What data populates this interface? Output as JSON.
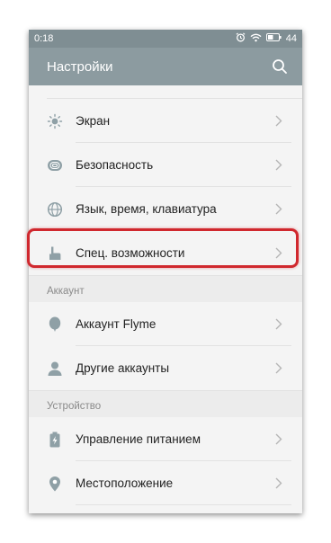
{
  "status_bar": {
    "time": "0:18",
    "battery": "44"
  },
  "app_bar": {
    "title": "Настройки"
  },
  "colors": {
    "accent_bar": "#8c9ba0",
    "icon": "#8fa0a6",
    "highlight": "#d0282e"
  },
  "settings": {
    "display_label": "Экран",
    "security_label": "Безопасность",
    "language_label": "Язык, время, клавиатура",
    "accessibility_label": "Спец. возможности"
  },
  "account": {
    "header": "Аккаунт",
    "flyme_label": "Аккаунт Flyme",
    "other_label": "Другие аккаунты"
  },
  "device": {
    "header": "Устройство",
    "power_label": "Управление питанием",
    "location_label": "Местоположение"
  }
}
